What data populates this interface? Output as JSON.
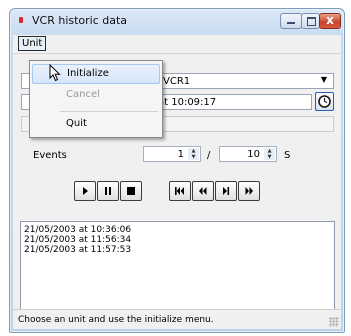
{
  "window": {
    "title": "VCR historic data",
    "close_glyph": "x"
  },
  "menubar": {
    "unit_label": "Unit"
  },
  "menu": {
    "items": [
      {
        "label": "Initialize",
        "state": "hover"
      },
      {
        "label": "Cancel",
        "state": "disabled"
      },
      {
        "label": "Quit",
        "state": "normal"
      }
    ]
  },
  "form": {
    "vcr_select_value": "_VCR1",
    "datetime_value": "at 10:09:17",
    "events_label": "Events",
    "from_value": "1",
    "separator": "/",
    "to_value": "10",
    "unit_suffix": "S"
  },
  "playback": {
    "buttons": [
      "play-icon",
      "pause-icon",
      "stop-icon"
    ],
    "navigation": [
      "first-icon",
      "rewind-icon",
      "step-forward-icon",
      "fast-forward-icon"
    ]
  },
  "log": {
    "lines": [
      "21/05/2003 at 10:36:06",
      "21/05/2003 at 11:56:34",
      "21/05/2003 at 11:57:53"
    ]
  },
  "status": {
    "text": "Choose an unit and use the initialize menu."
  },
  "colors": {
    "accent_blue": "#2a5fb0",
    "close_red": "#c6452c",
    "app_dot": "#d42b2b"
  }
}
